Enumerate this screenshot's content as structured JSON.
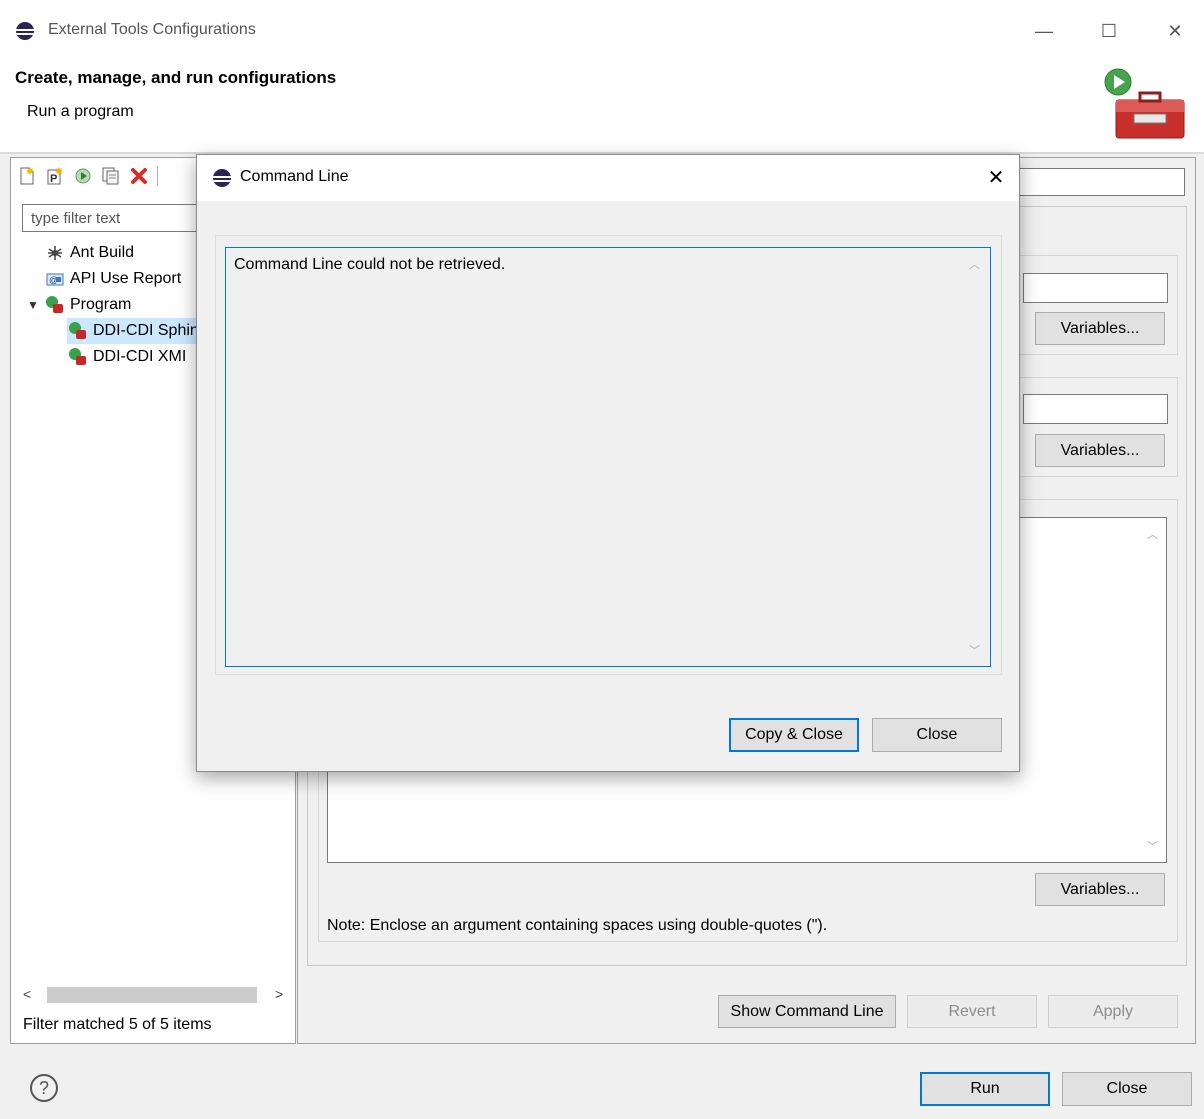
{
  "window": {
    "title": "External Tools Configurations",
    "controls": {
      "minimize": "—",
      "maximize": "☐",
      "close": "✕"
    }
  },
  "banner": {
    "heading": "Create, manage, and run configurations",
    "subheading": "Run a program"
  },
  "sidebar": {
    "filter_placeholder": "type filter text",
    "tree": [
      {
        "label": "Ant Build",
        "icon": "ant-icon",
        "level": 0
      },
      {
        "label": "API Use Report",
        "icon": "api-report-icon",
        "level": 0
      },
      {
        "label": "Program",
        "icon": "program-icon",
        "level": 0,
        "expanded": true
      },
      {
        "label": "DDI-CDI Sphinx",
        "icon": "program-config-icon",
        "level": 1,
        "selected": true
      },
      {
        "label": "DDI-CDI XMI",
        "icon": "program-config-icon",
        "level": 1
      }
    ],
    "filter_status": "Filter matched 5 of 5 items"
  },
  "main": {
    "variables_label": "Variables...",
    "note": "Note: Enclose an argument containing spaces using double-quotes (\").",
    "show_command_line": "Show Command Line",
    "revert": "Revert",
    "apply": "Apply"
  },
  "footer": {
    "help": "?",
    "run": "Run",
    "close": "Close"
  },
  "dialog": {
    "title": "Command Line",
    "close_glyph": "✕",
    "message": "Command Line could not be retrieved.",
    "copy_close": "Copy & Close",
    "close": "Close"
  },
  "colors": {
    "accent": "#0078d7",
    "selection": "#cce8ff",
    "background": "#f0f0f0"
  }
}
